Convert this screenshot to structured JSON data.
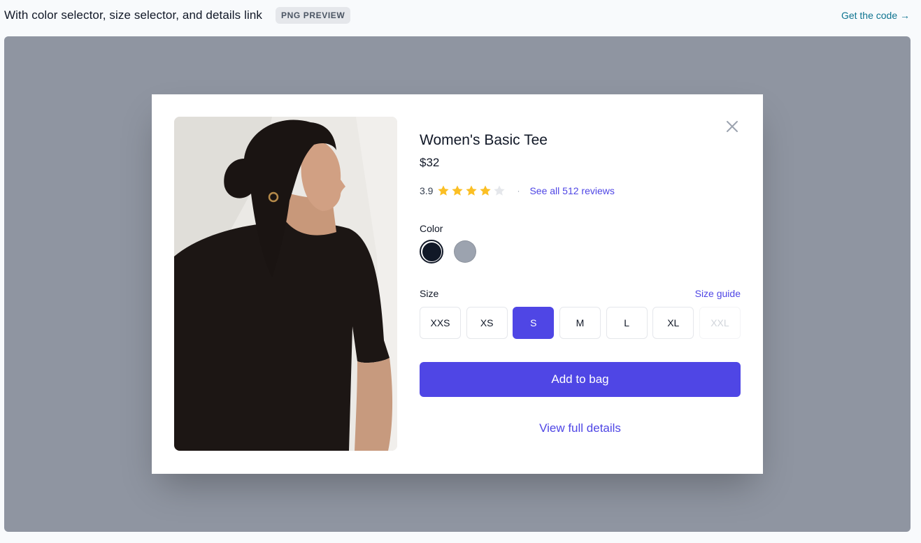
{
  "header": {
    "title": "With color selector, size selector, and details link",
    "badge": "PNG PREVIEW",
    "get_code": "Get the code →"
  },
  "product": {
    "name": "Women's Basic Tee",
    "price": "$32",
    "rating": "3.9",
    "rating_value": 3.9,
    "rating_max": 5,
    "reviews_link": "See all 512 reviews",
    "image_icon": "product-photo",
    "color_label": "Color",
    "colors": [
      {
        "name": "Black",
        "hex": "#111827",
        "selected": true
      },
      {
        "name": "Gray",
        "hex": "#9ca3af",
        "selected": false
      }
    ],
    "size_label": "Size",
    "size_guide": "Size guide",
    "sizes": [
      {
        "label": "XXS",
        "state": "available"
      },
      {
        "label": "XS",
        "state": "available"
      },
      {
        "label": "S",
        "state": "selected"
      },
      {
        "label": "M",
        "state": "available"
      },
      {
        "label": "L",
        "state": "available"
      },
      {
        "label": "XL",
        "state": "available"
      },
      {
        "label": "XXL",
        "state": "disabled"
      }
    ],
    "add_to_bag": "Add to bag",
    "view_full_details": "View full details"
  },
  "icons": {
    "close": "close-icon",
    "star": "star-icon"
  },
  "colors": {
    "accent": "#4f46e5",
    "star_filled": "#fbbf24",
    "star_empty": "#e5e7eb",
    "overlay": "#8f95a1"
  }
}
